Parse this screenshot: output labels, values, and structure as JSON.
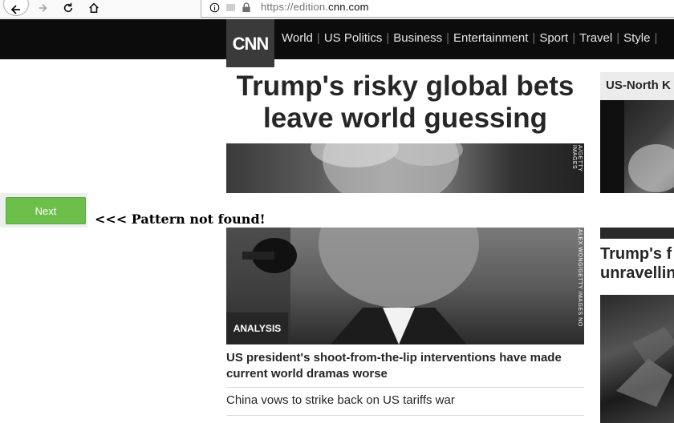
{
  "browser": {
    "url_prefix": "https://edition.",
    "url_domain": "cnn.com"
  },
  "header": {
    "logo_text": "CNN",
    "nav": [
      "World",
      "US Politics",
      "Business",
      "Entertainment",
      "Sport",
      "Travel",
      "Style"
    ]
  },
  "main": {
    "headline": "Trump's risky global bets leave world guessing",
    "photo_credit_top": "A/GETTY IMAGES",
    "photo_credit_bottom": "ALEX WONG/GETTY IMAGES NO",
    "badge": "ANALYSIS",
    "story_headline": "US president's shoot-from-the-lip interventions have made current world dramas worse",
    "story_link": "China vows to strike back on US tariffs war"
  },
  "right": {
    "kicker": "US-North K",
    "headline_line1": "Trump's f",
    "headline_line2": "unravellin"
  },
  "overlay": {
    "next_label": "Next",
    "message": "<<< Pattern not found!"
  },
  "colors": {
    "header_bg": "#0c0c0c",
    "next_button": "#6cc04a",
    "logo_bg": "#3a3a3a"
  }
}
